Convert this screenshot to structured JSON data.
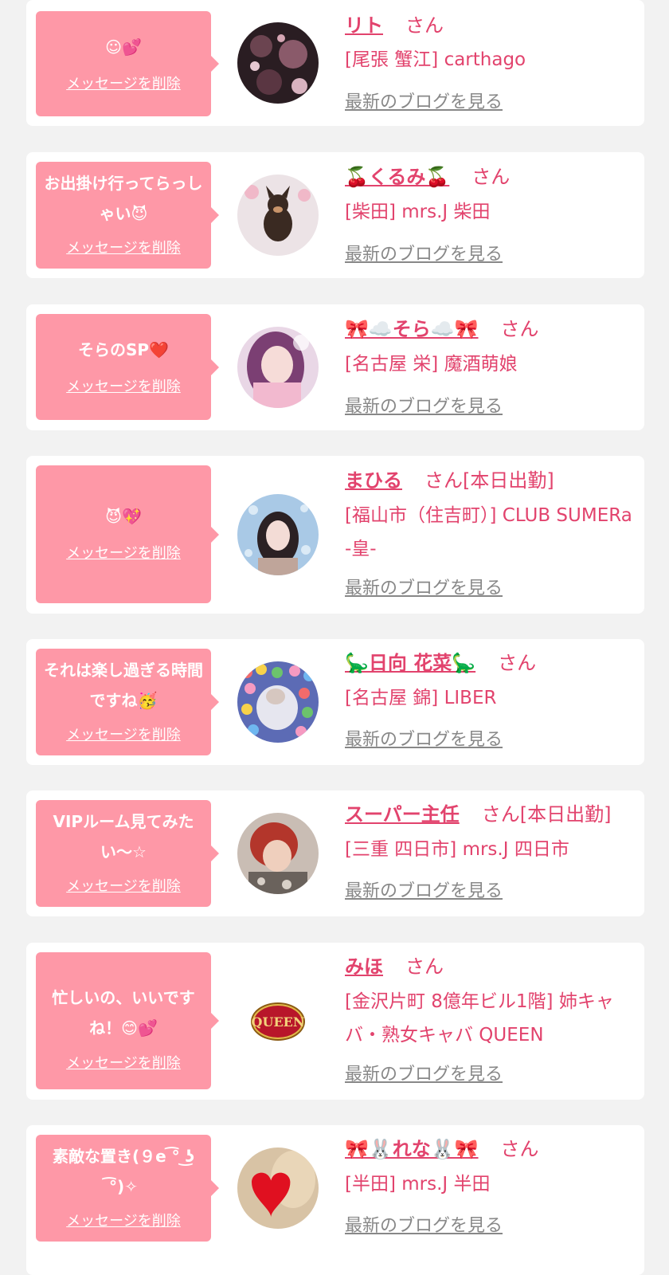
{
  "actions": {
    "delete_label": "メッセージを削除",
    "blog_label": "最新のブログを見る"
  },
  "colors": {
    "accent_pink": "#e2436d",
    "bubble_pink": "#fe98a7",
    "link_gray": "#888888",
    "page_bg": "#f2f2f2"
  },
  "cards": [
    {
      "message": "☺︎💕",
      "name": "リト",
      "suffix": "さん",
      "shop": "[尾張 蟹江] carthago",
      "avatar_icon": "avatar-photo-dark-pattern"
    },
    {
      "message": "お出掛け行ってらっしゃい😈",
      "name": "🍒くるみ🍒",
      "suffix": "さん",
      "shop": "[柴田] mrs.J 柴田",
      "avatar_icon": "avatar-photo-dog"
    },
    {
      "message": "そらのSP❤️",
      "name": "🎀☁️そら☁️🎀",
      "suffix": "さん",
      "shop": "[名古屋 栄] 魔酒萌娘",
      "avatar_icon": "avatar-photo-purple-hair"
    },
    {
      "message": "😈💖",
      "name": "まひる",
      "suffix": "さん[本日出勤]",
      "shop": "[福山市（住吉町）] CLUB SUMERa -皇-",
      "avatar_icon": "avatar-photo-blue-sparkle"
    },
    {
      "message": "それは楽し過ぎる時間ですね🥳",
      "name": "🦕日向 花菜🦕",
      "suffix": "さん",
      "shop": "[名古屋 錦] LIBER",
      "avatar_icon": "avatar-photo-ball-pit"
    },
    {
      "message": "VIPルーム見てみたい〜☆",
      "name": "スーパー主任",
      "suffix": "さん[本日出勤]",
      "shop": "[三重 四日市] mrs.J 四日市",
      "avatar_icon": "avatar-photo-red-hair"
    },
    {
      "message": "忙しいの、いいですね！😊💕",
      "name": "みほ",
      "suffix": "さん",
      "shop": "[金沢片町 8億年ビル1階] 姉キャバ・熟女キャバ QUEEN",
      "avatar_icon": "avatar-logo-queen",
      "avatar_text": "QUEEN"
    },
    {
      "message": "素敵な置き(９e ͡° ͜ʖ ͡°)✧",
      "name": "🎀🐰れな🐰🎀",
      "suffix": "さん",
      "shop": "[半田] mrs.J 半田",
      "avatar_icon": "avatar-photo-heart"
    }
  ]
}
